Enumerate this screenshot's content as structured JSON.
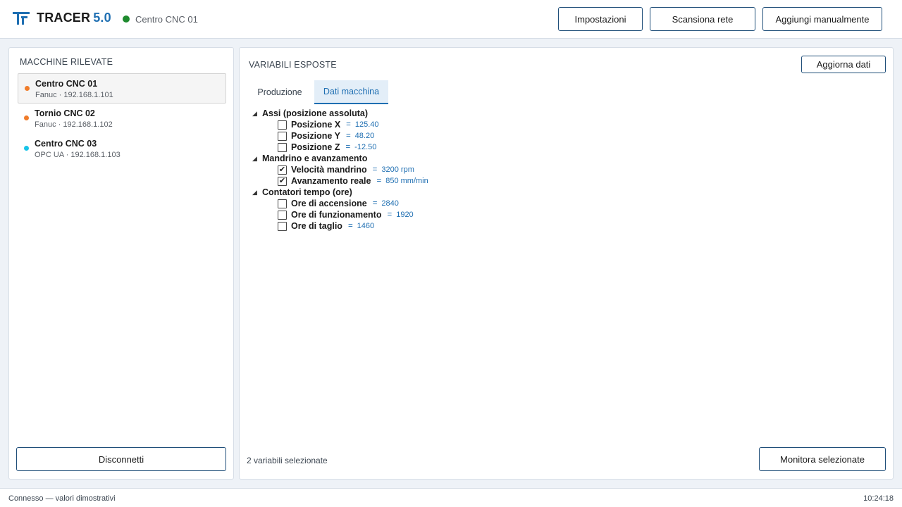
{
  "app": {
    "name": "TRACER",
    "version": "5.0",
    "connected_machine": "Centro CNC 01"
  },
  "colors": {
    "accent": "#1f6fb2",
    "connected": "#1e8a2e",
    "fanuc": "#f07c2a",
    "opcua": "#19c4e8"
  },
  "header": {
    "buttons": {
      "settings": "Impostazioni",
      "scan": "Scansiona rete",
      "add_manual": "Aggiungi manualmente"
    }
  },
  "sidebar": {
    "title": "MACCHINE RILEVATE",
    "machines": [
      {
        "name": "Centro CNC 01",
        "detail": "Fanuc · 192.168.1.101",
        "selected": true
      },
      {
        "name": "Tornio CNC 02",
        "detail": "Fanuc · 192.168.1.102",
        "selected": false
      },
      {
        "name": "Centro CNC 03",
        "detail": "OPC UA · 192.168.1.103",
        "selected": false
      }
    ],
    "disconnect": "Disconnetti"
  },
  "main": {
    "title": "VARIABILI ESPOSTE",
    "refresh": "Aggiorna dati",
    "tabs": [
      {
        "label": "Produzione",
        "active": false
      },
      {
        "label": "Dati macchina",
        "active": true
      }
    ],
    "groups": [
      {
        "label": "Assi (posizione assoluta)",
        "vars": [
          {
            "name": "Posizione X",
            "value": "125.40",
            "checked": false
          },
          {
            "name": "Posizione Y",
            "value": "48.20",
            "checked": false
          },
          {
            "name": "Posizione Z",
            "value": "-12.50",
            "checked": false
          }
        ]
      },
      {
        "label": "Mandrino e avanzamento",
        "vars": [
          {
            "name": "Velocità mandrino",
            "value": "3200 rpm",
            "checked": true
          },
          {
            "name": "Avanzamento reale",
            "value": "850 mm/min",
            "checked": true
          }
        ]
      },
      {
        "label": "Contatori tempo (ore)",
        "vars": [
          {
            "name": "Ore di accensione",
            "value": "2840",
            "checked": false
          },
          {
            "name": "Ore di funzionamento",
            "value": "1920",
            "checked": false
          },
          {
            "name": "Ore di taglio",
            "value": "1460",
            "checked": false
          }
        ]
      }
    ],
    "selected_count": "2 variabili selezionate",
    "monitor": "Monitora selezionate"
  },
  "statusbar": {
    "text": "Connesso — valori dimostrativi",
    "time": "10:24:18"
  }
}
